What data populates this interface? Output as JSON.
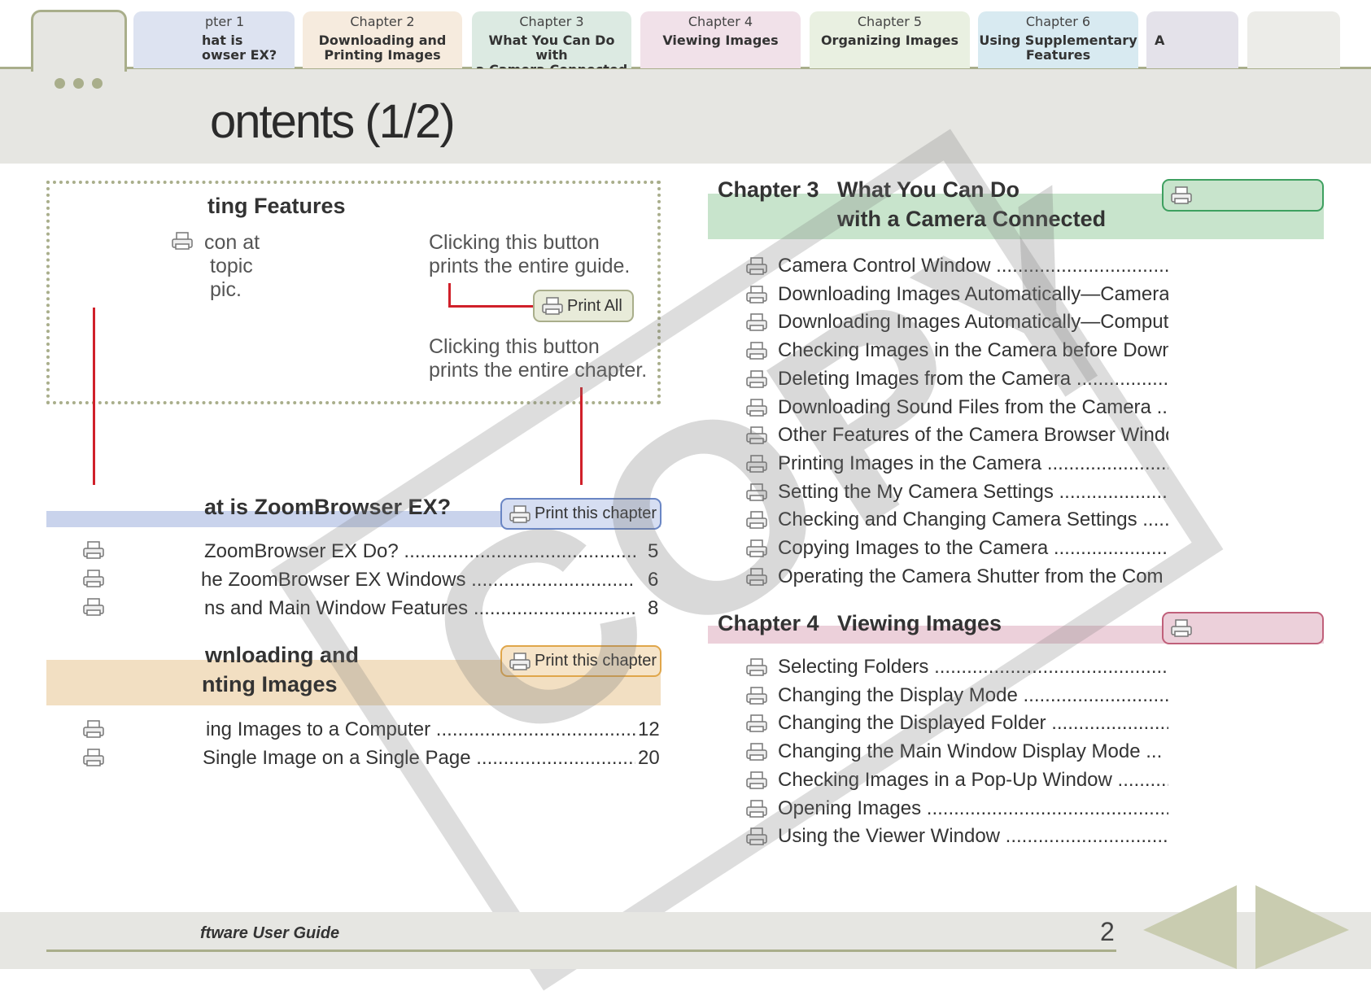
{
  "tabs": [
    {
      "number": "pter 1",
      "title": "hat is\nowser EX?"
    },
    {
      "number": "Chapter 2",
      "title": "Downloading and\nPrinting Images"
    },
    {
      "number": "Chapter 3",
      "title": "What You Can Do with\na Camera Connected"
    },
    {
      "number": "Chapter 4",
      "title": "Viewing Images"
    },
    {
      "number": "Chapter 5",
      "title": "Organizing Images"
    },
    {
      "number": "Chapter 6",
      "title": "Using Supplementary\nFeatures"
    },
    {
      "number": "",
      "title": "A"
    },
    {
      "number": "",
      "title": ""
    }
  ],
  "page_title": "ontents (1/2)",
  "print_features": {
    "heading": "ting Features",
    "icon_text": [
      "con at",
      "topic",
      "pic."
    ],
    "guide_text": [
      "Clicking this button",
      "prints the entire guide."
    ],
    "print_all_label": "Print All",
    "chapter_text": [
      "Clicking this button",
      "prints the entire chapter."
    ]
  },
  "left_sections": [
    {
      "title": [
        "at is ZoomBrowser EX?"
      ],
      "button_label": "Print this chapter",
      "entries": [
        {
          "text": "ZoomBrowser EX Do? ................................................",
          "page": "5"
        },
        {
          "text": "he ZoomBrowser EX Windows ...................................",
          "page": "6"
        },
        {
          "text": "ns and Main Window Features ..................................",
          "page": "8"
        }
      ]
    },
    {
      "title": [
        "wnloading and",
        "nting Images"
      ],
      "button_label": "Print this chapter",
      "entries": [
        {
          "text": "ing Images to a Computer ........................................",
          "page": "12"
        },
        {
          "text": "Single Image on a Single Page ..................................",
          "page": "20"
        }
      ]
    }
  ],
  "right_sections": [
    {
      "label": "Chapter 3",
      "title": [
        "What You Can Do",
        "with a Camera Connected"
      ],
      "entries": [
        "Camera Control Window ....................................",
        "Downloading Images Automatically—Camera O",
        "Downloading Images Automatically—Compute",
        "Checking Images in the Camera before Downl",
        "Deleting Images from the Camera .....................",
        "Downloading Sound Files from the Camera ...",
        "Other Features of the Camera Browser Windo",
        "Printing Images in the Camera ..........................",
        "Setting the My Camera Settings ........................",
        "Checking and Changing Camera Settings ......",
        "Copying Images to the Camera .........................",
        "Operating the Camera Shutter from the Com"
      ]
    },
    {
      "label": "Chapter 4",
      "title": [
        "Viewing Images"
      ],
      "entries": [
        "Selecting Folders ...................................................",
        "Changing the Display Mode ..............................",
        "Changing the Displayed Folder ........................",
        "Changing the Main Window Display Mode ...",
        "Checking Images in a Pop-Up Window ..........",
        "Opening Images .....................................................",
        "Using the Viewer Window ..............................."
      ]
    }
  ],
  "footer": {
    "text": "ftware User Guide",
    "page": "2"
  },
  "watermark": "COPY",
  "colors": {
    "accent": "#a9ae8b",
    "header_band": "#e6e6e2",
    "chapter1": "#c9d3ec",
    "chapter2": "#f2dfc2",
    "chapter3": "#c8e4cc",
    "chapter4": "#ecd0da",
    "chapter5": "#e4ebd6",
    "chapter6": "#cfe4ee",
    "red": "#d0202a"
  }
}
